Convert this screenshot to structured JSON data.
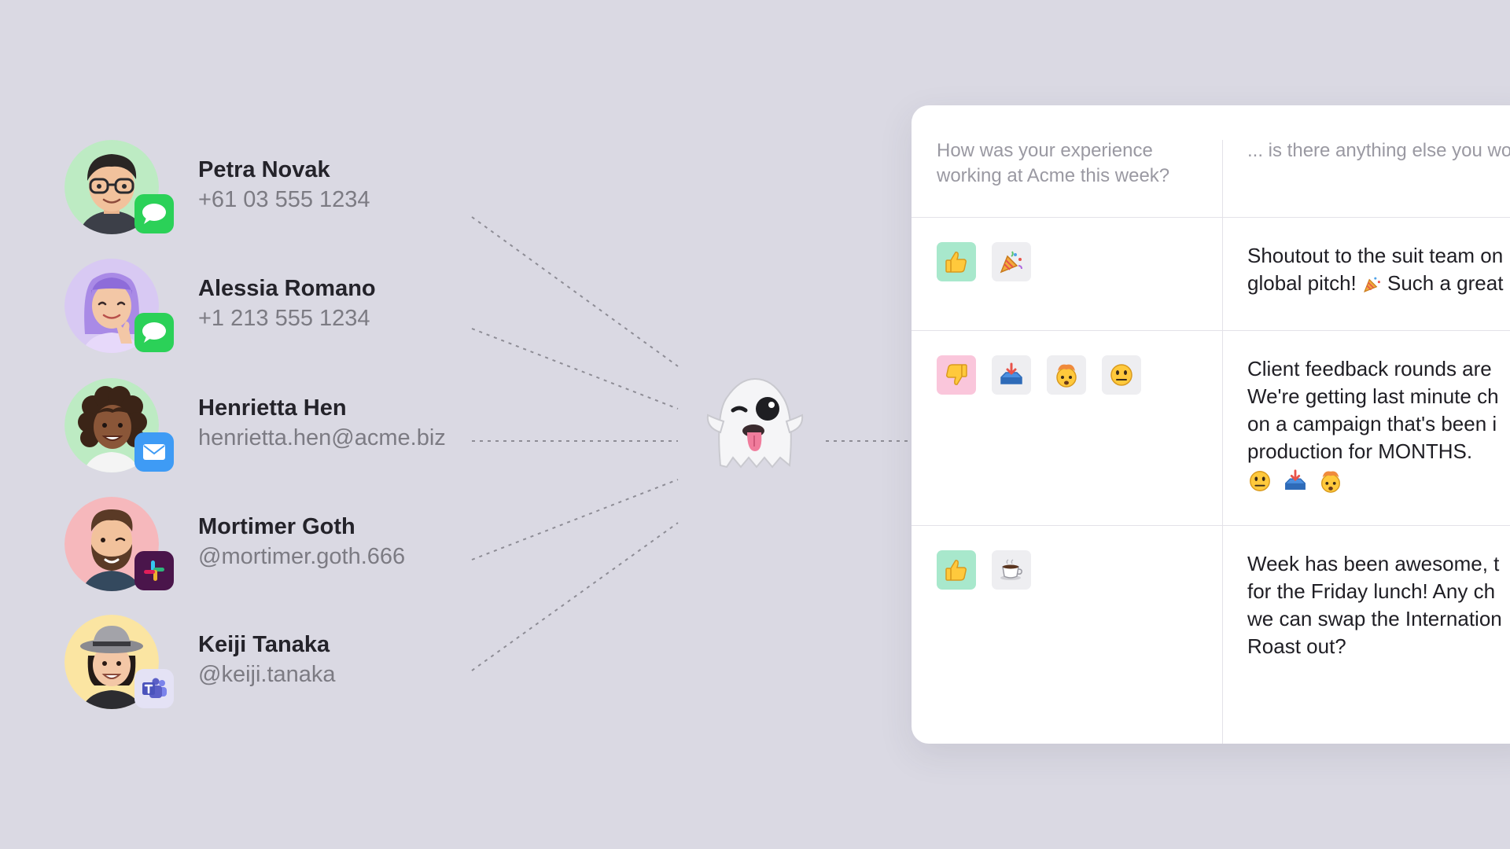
{
  "contacts": [
    {
      "name": "Petra Novak",
      "handle": "+61 03 555 1234",
      "channel": "messages-icon",
      "avatar_bg": "#BDEBC3"
    },
    {
      "name": "Alessia Romano",
      "handle": "+1 213 555 1234",
      "channel": "messages-icon",
      "avatar_bg": "#D8C9F3"
    },
    {
      "name": "Henrietta Hen",
      "handle": "henrietta.hen@acme.biz",
      "channel": "mail-icon",
      "avatar_bg": "#BDEBC3"
    },
    {
      "name": "Mortimer Goth",
      "handle": "@mortimer.goth.666",
      "channel": "slack-icon",
      "avatar_bg": "#F6B8BC"
    },
    {
      "name": "Keiji Tanaka",
      "handle": "@keiji.tanaka",
      "channel": "teams-icon",
      "avatar_bg": "#FBE5A2"
    }
  ],
  "center_icon": "ghost-emoji-icon",
  "survey": {
    "questions": [
      "How was your experience working at Acme this week?",
      "... is there anything else you would like to add?"
    ],
    "responses": [
      {
        "reactions": [
          "thumbs-up-icon",
          "party-popper-icon"
        ],
        "comment_lines": [
          "Shoutout to the suit team on",
          "global pitch!",
          "Such a great"
        ]
      },
      {
        "reactions": [
          "thumbs-down-icon",
          "inbox-tray-icon",
          "exploding-head-icon",
          "neutral-face-icon"
        ],
        "comment_lines": [
          "Client feedback rounds are",
          "We're getting last minute ch",
          "on a campaign that's been i",
          "production for MONTHS."
        ]
      },
      {
        "reactions": [
          "thumbs-up-icon",
          "hot-beverage-icon"
        ],
        "comment_lines": [
          "Week has been awesome, t",
          "for the Friday lunch! Any ch",
          "we can swap the Internation",
          "Roast out?"
        ]
      }
    ]
  },
  "colors": {
    "background": "#DAD9E3",
    "messages_badge": "#2BD158",
    "mail_badge": "#3E9BF5",
    "slack_badge": "#4A154B",
    "teams_badge": "#5B5FC7",
    "positive_chip": "#A8E8CC",
    "negative_chip": "#FAC6DB",
    "neutral_chip": "#EEEEF1"
  }
}
